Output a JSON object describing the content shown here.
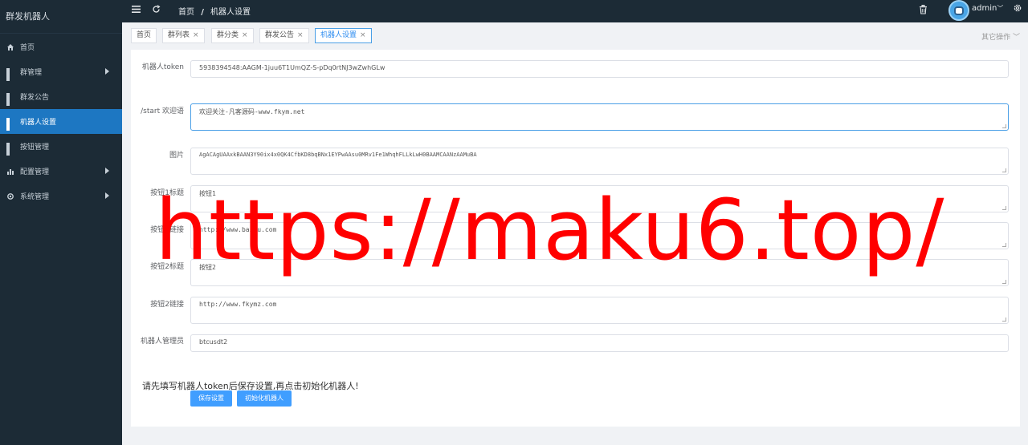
{
  "app_title": "群发机器人",
  "sidebar": {
    "items": [
      {
        "label": "首页"
      },
      {
        "label": "群管理"
      },
      {
        "label": "群发公告"
      },
      {
        "label": "机器人设置"
      },
      {
        "label": "按钮管理"
      },
      {
        "label": "配置管理"
      },
      {
        "label": "系统管理"
      }
    ]
  },
  "header": {
    "breadcrumb": [
      "首页",
      "机器人设置"
    ],
    "breadcrumb_sep": "/",
    "username": "admin",
    "username_caret": "﹀"
  },
  "tabs": [
    {
      "label": "首页",
      "closable": false
    },
    {
      "label": "群列表",
      "closable": true
    },
    {
      "label": "群分类",
      "closable": true
    },
    {
      "label": "群发公告",
      "closable": true
    },
    {
      "label": "机器人设置",
      "closable": true
    }
  ],
  "tab_close_symbol": "×",
  "other_ops": "其它操作",
  "form": {
    "bot_token_label": "机器人token",
    "bot_token_value": "5938394548:AAGM-1juu6T1UmQZ-S-pDq0rtNJ3wZwhGLw",
    "start_welcome_label": "/start 欢迎语",
    "start_welcome_value": "欢迎关注-凡客源码-www.fkym.net",
    "image_label": "图片",
    "image_value": "AgACAgUAAxkBAAN3Y90ix4x0QK4CfbKD8bqBNx1EYPwAAsu0MRv1Fe1WhqhFLLkLwH0BAAMCAANzAAMuBA",
    "button1_title_label": "按钮1标题",
    "button1_title_value": "按钮1",
    "button1_link_label": "按钮1链接",
    "button1_link_value": "http://www.baidu.com",
    "button2_title_label": "按钮2标题",
    "button2_title_value": "按钮2",
    "button2_link_label": "按钮2链接",
    "button2_link_value": "http://www.fkymz.com",
    "bot_admin_label": "机器人管理员",
    "bot_admin_value": "btcusdt2"
  },
  "hint": "请先填写机器人token后保存设置,再点击初始化机器人!",
  "buttons": {
    "save": "保存设置",
    "init": "初始化机器人"
  },
  "watermark": "https://maku6.top/",
  "colors": {
    "sidebar_bg": "#1c2b36",
    "active_menu": "#1d77c2",
    "primary_button": "#409eff",
    "watermark": "#ff0000"
  }
}
